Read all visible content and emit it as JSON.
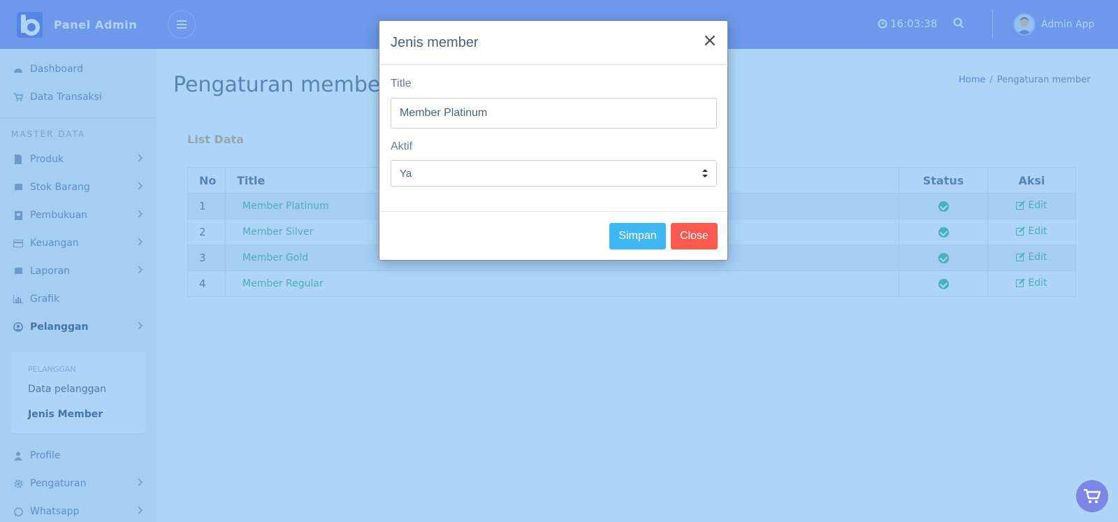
{
  "header": {
    "brand": "Panel Admin",
    "clock": "16:03:38",
    "user_name": "Admin App"
  },
  "sidebar": {
    "section_label": "MASTER DATA",
    "items_top": [
      {
        "label": "Dashboard",
        "icon": "dashboard-icon"
      },
      {
        "label": "Data Transaksi",
        "icon": "cart-icon"
      }
    ],
    "items": [
      {
        "label": "Produk",
        "icon": "file-icon"
      },
      {
        "label": "Stok Barang",
        "icon": "book-icon"
      },
      {
        "label": "Pembukuan",
        "icon": "ledger-icon"
      },
      {
        "label": "Keuangan",
        "icon": "credit-card-icon"
      },
      {
        "label": "Laporan",
        "icon": "book-icon"
      },
      {
        "label": "Grafik",
        "icon": "bar-chart-icon"
      },
      {
        "label": "Pelanggan",
        "icon": "user-circle-icon"
      }
    ],
    "submenu": {
      "label": "PELANGGAN",
      "items": [
        "Data pelanggan",
        "Jenis Member"
      ]
    },
    "items_bottom": [
      {
        "label": "Profile",
        "icon": "user-icon"
      },
      {
        "label": "Pengaturan",
        "icon": "gear-icon"
      },
      {
        "label": "Whatsapp",
        "icon": "whatsapp-icon"
      }
    ]
  },
  "page": {
    "title": "Pengaturan member",
    "breadcrumb": {
      "home": "Home",
      "separator": "/",
      "current": "Pengaturan member"
    }
  },
  "card": {
    "title": "List Data",
    "columns": [
      "No",
      "Title",
      "Status",
      "Aksi"
    ],
    "rows": [
      {
        "no": "1",
        "title": "Member Platinum",
        "action": "Edit"
      },
      {
        "no": "2",
        "title": "Member Silver",
        "action": "Edit"
      },
      {
        "no": "3",
        "title": "Member Gold",
        "action": "Edit"
      },
      {
        "no": "4",
        "title": "Member Regular",
        "action": "Edit"
      }
    ]
  },
  "modal": {
    "title": "Jenis member",
    "close_symbol": "×",
    "title_label": "Title",
    "title_value": "Member Platinum",
    "aktif_label": "Aktif",
    "aktif_value": "Ya",
    "save_label": "Simpan",
    "close_label": "Close"
  },
  "colors": {
    "header": "#7c86e6",
    "overlay": "#5daaf0",
    "save": "#3fb8f2",
    "close": "#fc5a4f",
    "link_green": "#3fae7f"
  }
}
